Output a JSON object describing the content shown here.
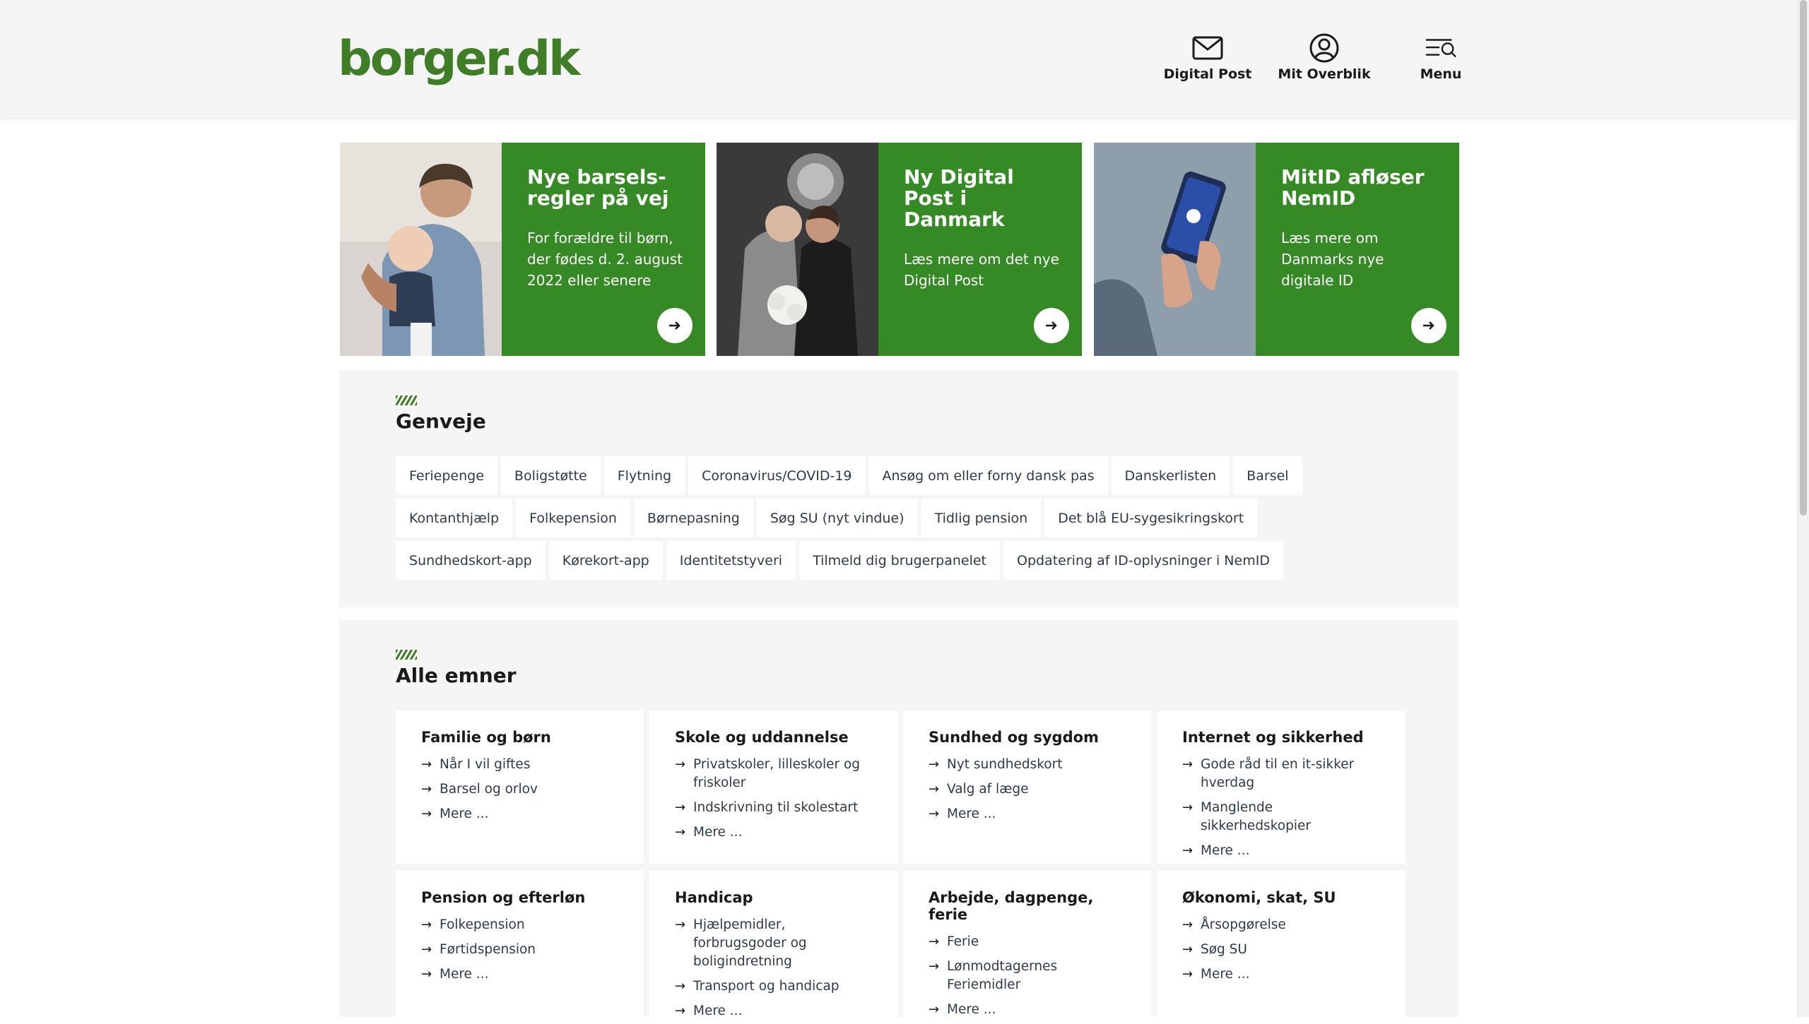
{
  "header": {
    "logo": "borger.dk",
    "nav": [
      {
        "label": "Digital Post",
        "icon": "envelope-icon"
      },
      {
        "label": "Mit Overblik",
        "icon": "user-circle-icon"
      },
      {
        "label": "Menu",
        "icon": "menu-search-icon"
      }
    ]
  },
  "promos": [
    {
      "title": "Nye barsels-\nregler på vej",
      "text": "For forældre til børn, der fødes d. 2. august 2022 eller senere",
      "image": "father-baby-photo",
      "icon": "arrow-right-icon"
    },
    {
      "title": "Ny Digital Post i Danmark",
      "text": "Læs mere om det nye Digital Post",
      "image": "wedding-couple-photo",
      "icon": "arrow-right-icon"
    },
    {
      "title": "MitID afløser NemID",
      "text": "Læs mere om Danmarks nye digitale ID",
      "image": "phone-hands-photo",
      "icon": "arrow-right-icon"
    }
  ],
  "shortcuts": {
    "title": "Genveje",
    "items": [
      "Feriepenge",
      "Boligstøtte",
      "Flytning",
      "Coronavirus/COVID-19",
      "Ansøg om eller forny dansk pas",
      "Danskerlisten",
      "Barsel",
      "Kontanthjælp",
      "Folkepension",
      "Børnepasning",
      "Søg SU (nyt vindue)",
      "Tidlig pension",
      "Det blå EU-sygesikringskort",
      "Sundhedskort-app",
      "Kørekort-app",
      "Identitetstyveri",
      "Tilmeld dig brugerpanelet",
      "Opdatering af ID-oplysninger i NemID"
    ]
  },
  "topics": {
    "title": "Alle emner",
    "cards": [
      {
        "title": "Familie og børn",
        "links": [
          "Når I vil giftes",
          "Barsel og orlov",
          "Mere ..."
        ]
      },
      {
        "title": "Skole og uddannelse",
        "links": [
          "Privatskoler, lilleskoler og friskoler",
          "Indskrivning til skolestart",
          "Mere ..."
        ]
      },
      {
        "title": "Sundhed og sygdom",
        "links": [
          "Nyt sundhedskort",
          "Valg af læge",
          "Mere ..."
        ]
      },
      {
        "title": "Internet og sikkerhed",
        "links": [
          "Gode råd til en it-sikker hverdag",
          "Manglende sikkerhedskopier",
          "Mere ..."
        ]
      },
      {
        "title": "Pension og efterløn",
        "links": [
          "Folkepension",
          "Førtidspension",
          "Mere ..."
        ]
      },
      {
        "title": "Handicap",
        "links": [
          "Hjælpemidler, forbrugsgoder og boligindretning",
          "Transport og handicap",
          "Mere ..."
        ]
      },
      {
        "title": "Arbejde, dagpenge, ferie",
        "links": [
          "Ferie",
          "Lønmodtagernes Feriemidler",
          "Mere ..."
        ]
      },
      {
        "title": "Økonomi, skat, SU",
        "links": [
          "Årsopgørelse",
          "Søg SU",
          "Mere ..."
        ]
      }
    ]
  },
  "colors": {
    "brand_green": "#3f7d26",
    "card_green": "#358a25",
    "section_bg": "#f5f5f5"
  }
}
